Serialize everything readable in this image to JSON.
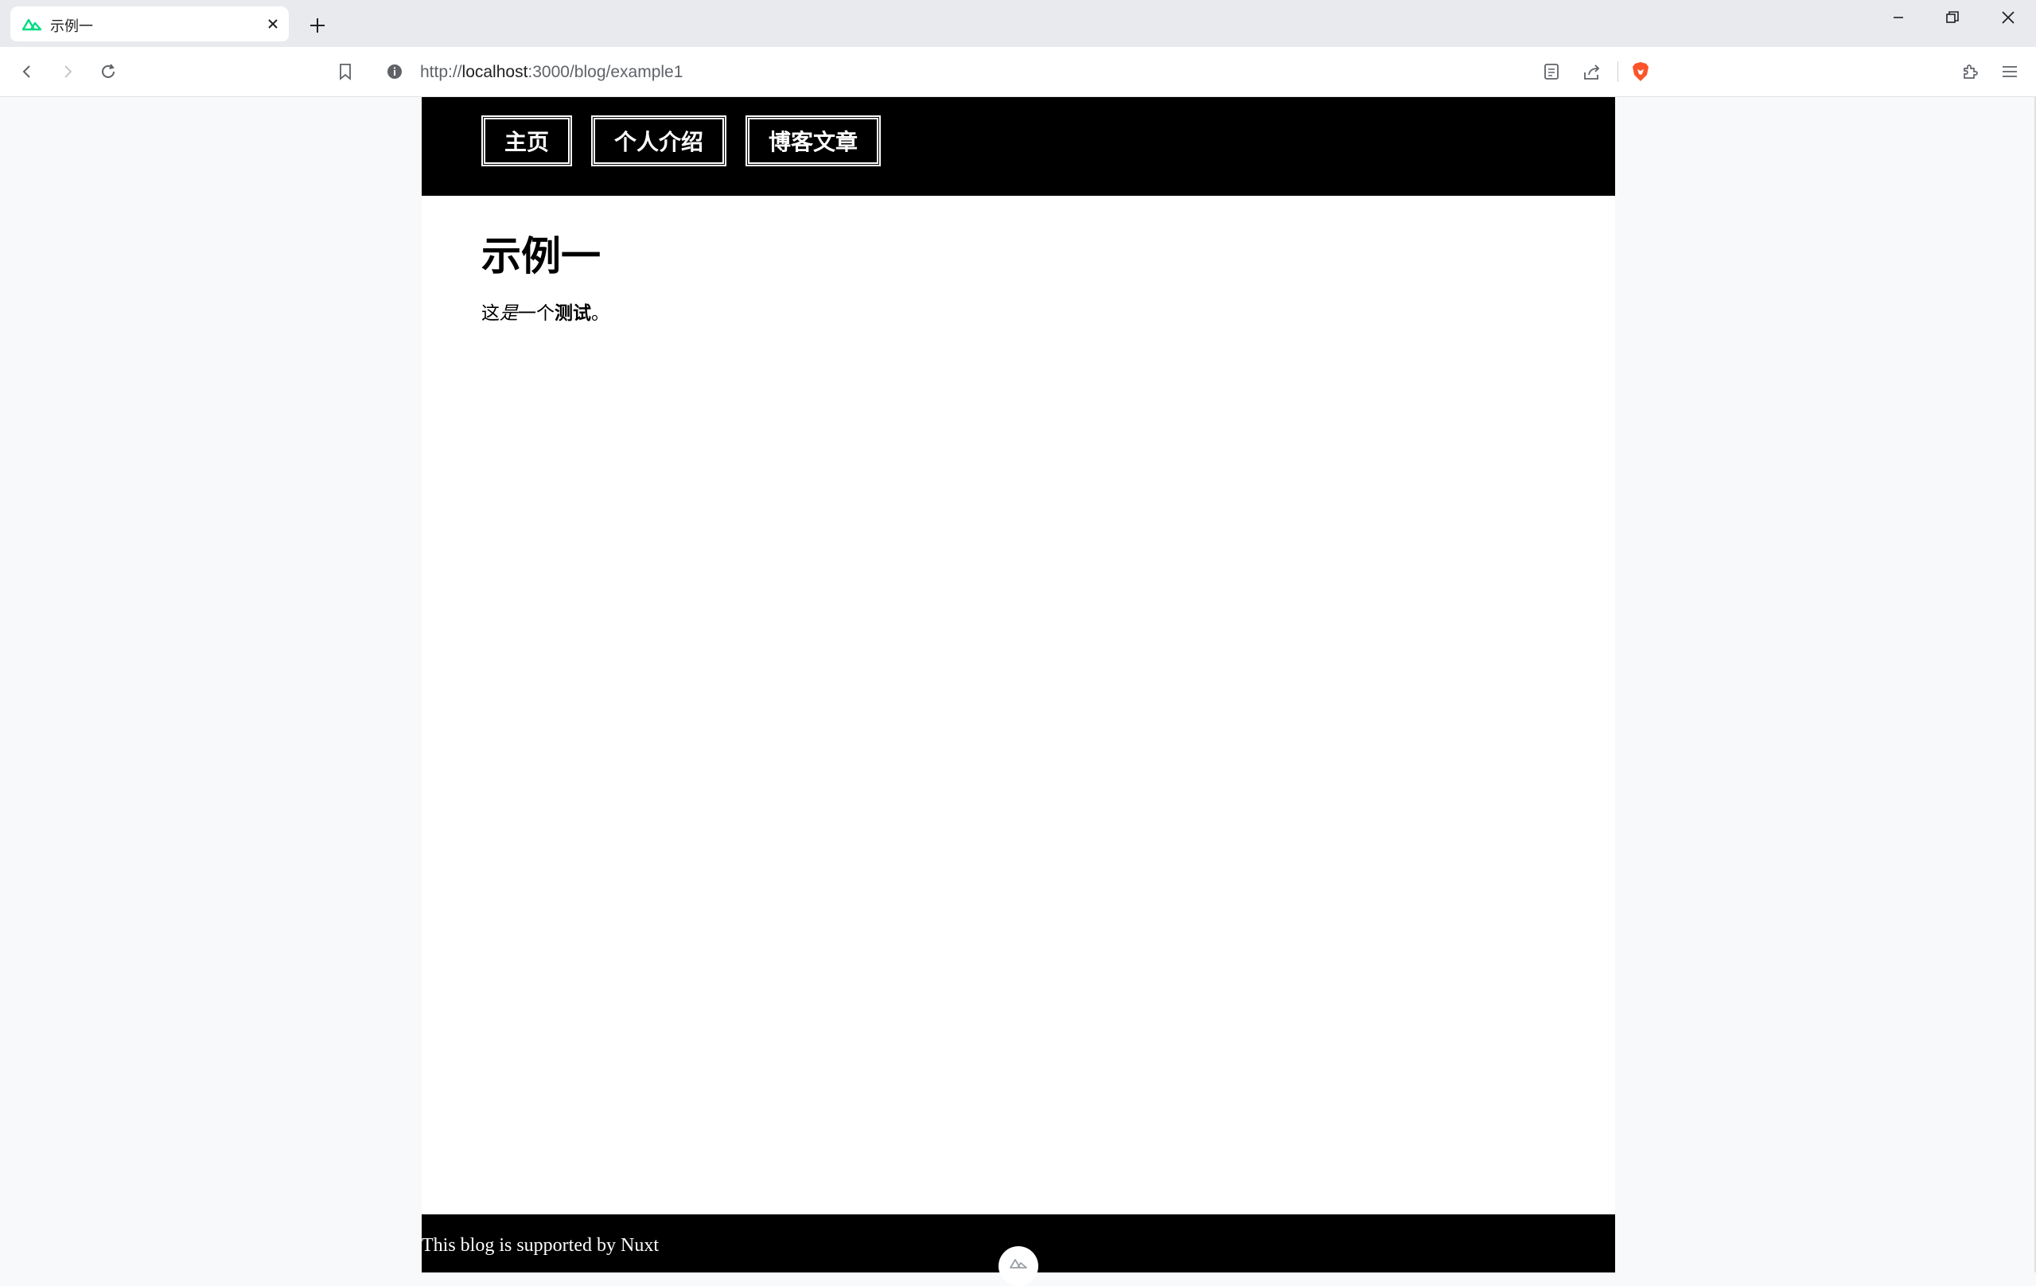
{
  "browser": {
    "tab_title": "示例一",
    "url_scheme": "http://",
    "url_host": "localhost",
    "url_rest": ":3000/blog/example1",
    "favicon": "nuxt-logo-icon",
    "brand_color": "#fb542b",
    "nuxt_green": "#00dc82"
  },
  "nav": {
    "items": [
      {
        "label": "主页"
      },
      {
        "label": "个人介绍"
      },
      {
        "label": "博客文章"
      }
    ]
  },
  "article": {
    "title": "示例一",
    "body_plain": "这",
    "body_italic": "是",
    "body_regular": "一个",
    "body_bold": "测试",
    "body_end": "。"
  },
  "footer": {
    "text": "This blog is supported by Nuxt"
  }
}
